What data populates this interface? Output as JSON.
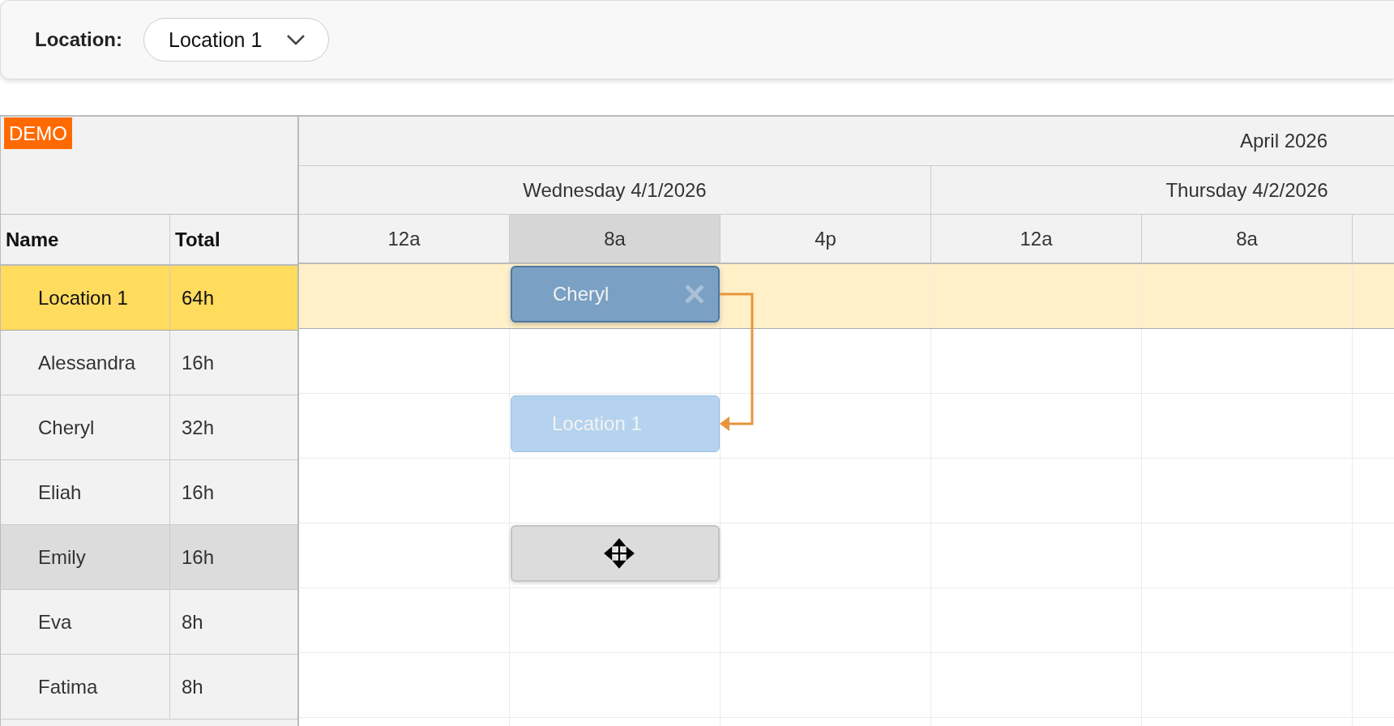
{
  "toolbar": {
    "label": "Location:",
    "dropdown": {
      "value": "Location 1"
    }
  },
  "badge": "DEMO",
  "timeline": {
    "month": "April 2026",
    "days": [
      "Wednesday 4/1/2026",
      "Thursday 4/2/2026"
    ],
    "hours": [
      {
        "label": "12a",
        "highlighted": false
      },
      {
        "label": "8a",
        "highlighted": true
      },
      {
        "label": "4p",
        "highlighted": false
      },
      {
        "label": "12a",
        "highlighted": false
      },
      {
        "label": "8a",
        "highlighted": false
      }
    ]
  },
  "columns": [
    "Name",
    "Total"
  ],
  "rows": [
    {
      "name": "Location 1",
      "total": "64h",
      "kind": "group",
      "selected": true,
      "highlighted": false,
      "event": {
        "kind": "group-event",
        "text": "Cheryl",
        "deletable": true,
        "link_source": true,
        "link_target": false
      }
    },
    {
      "name": "Alessandra",
      "total": "16h",
      "kind": "resource",
      "selected": false,
      "highlighted": false
    },
    {
      "name": "Cheryl",
      "total": "32h",
      "kind": "resource",
      "selected": false,
      "highlighted": false,
      "event": {
        "kind": "resource-event",
        "text": "Location 1",
        "deletable": false,
        "link_source": false,
        "link_target": true
      }
    },
    {
      "name": "Eliah",
      "total": "16h",
      "kind": "resource",
      "selected": false,
      "highlighted": false
    },
    {
      "name": "Emily",
      "total": "16h",
      "kind": "resource",
      "selected": false,
      "highlighted": true,
      "event": {
        "kind": "drop-preview",
        "deletable": false
      }
    },
    {
      "name": "Eva",
      "total": "8h",
      "kind": "resource",
      "selected": false,
      "highlighted": false
    },
    {
      "name": "Fatima",
      "total": "8h",
      "kind": "resource",
      "selected": false,
      "highlighted": false
    }
  ]
}
